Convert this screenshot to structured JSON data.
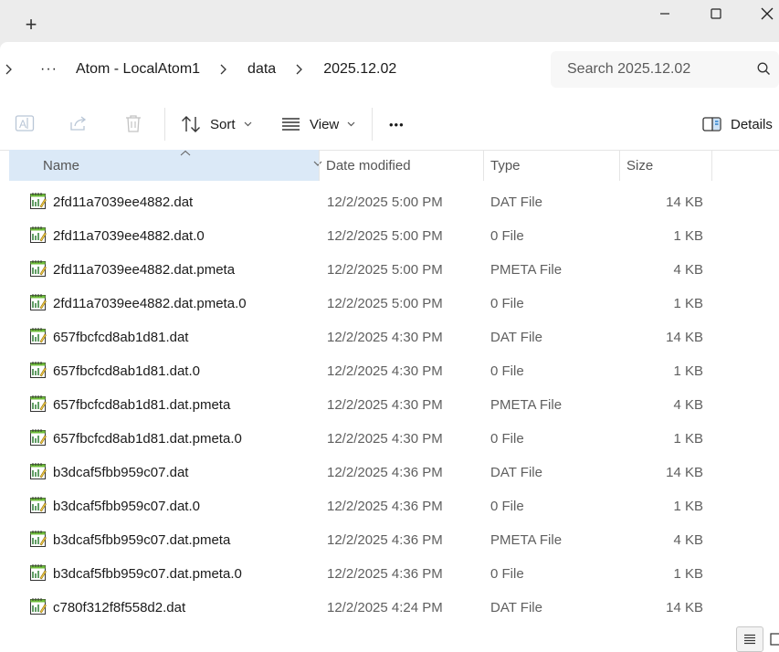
{
  "window": {
    "new_tab_label": "+"
  },
  "breadcrumb": {
    "items": [
      "Atom - LocalAtom1",
      "data",
      "2025.12.02"
    ],
    "more_label": "···"
  },
  "search": {
    "placeholder": "Search 2025.12.02"
  },
  "toolbar": {
    "sort_label": "Sort",
    "view_label": "View",
    "more_label": "•••",
    "details_label": "Details"
  },
  "columns": {
    "name": "Name",
    "date": "Date modified",
    "type": "Type",
    "size": "Size"
  },
  "files": [
    {
      "name": "2fd11a7039ee4882.dat",
      "date": "12/2/2025 5:00 PM",
      "type": "DAT File",
      "size": "14 KB"
    },
    {
      "name": "2fd11a7039ee4882.dat.0",
      "date": "12/2/2025 5:00 PM",
      "type": "0 File",
      "size": "1 KB"
    },
    {
      "name": "2fd11a7039ee4882.dat.pmeta",
      "date": "12/2/2025 5:00 PM",
      "type": "PMETA File",
      "size": "4 KB"
    },
    {
      "name": "2fd11a7039ee4882.dat.pmeta.0",
      "date": "12/2/2025 5:00 PM",
      "type": "0 File",
      "size": "1 KB"
    },
    {
      "name": "657fbcfcd8ab1d81.dat",
      "date": "12/2/2025 4:30 PM",
      "type": "DAT File",
      "size": "14 KB"
    },
    {
      "name": "657fbcfcd8ab1d81.dat.0",
      "date": "12/2/2025 4:30 PM",
      "type": "0 File",
      "size": "1 KB"
    },
    {
      "name": "657fbcfcd8ab1d81.dat.pmeta",
      "date": "12/2/2025 4:30 PM",
      "type": "PMETA File",
      "size": "4 KB"
    },
    {
      "name": "657fbcfcd8ab1d81.dat.pmeta.0",
      "date": "12/2/2025 4:30 PM",
      "type": "0 File",
      "size": "1 KB"
    },
    {
      "name": "b3dcaf5fbb959c07.dat",
      "date": "12/2/2025 4:36 PM",
      "type": "DAT File",
      "size": "14 KB"
    },
    {
      "name": "b3dcaf5fbb959c07.dat.0",
      "date": "12/2/2025 4:36 PM",
      "type": "0 File",
      "size": "1 KB"
    },
    {
      "name": "b3dcaf5fbb959c07.dat.pmeta",
      "date": "12/2/2025 4:36 PM",
      "type": "PMETA File",
      "size": "4 KB"
    },
    {
      "name": "b3dcaf5fbb959c07.dat.pmeta.0",
      "date": "12/2/2025 4:36 PM",
      "type": "0 File",
      "size": "1 KB"
    },
    {
      "name": "c780f312f8f558d2.dat",
      "date": "12/2/2025 4:24 PM",
      "type": "DAT File",
      "size": "14 KB"
    }
  ],
  "colors": {
    "selected_header": "#dbe9f7",
    "titlebar": "#ececec",
    "accent": "#0067c0"
  },
  "icons": {
    "file": "notepad-file-icon",
    "sort": "sort-icon",
    "view": "view-icon",
    "details": "details-pane-icon"
  }
}
